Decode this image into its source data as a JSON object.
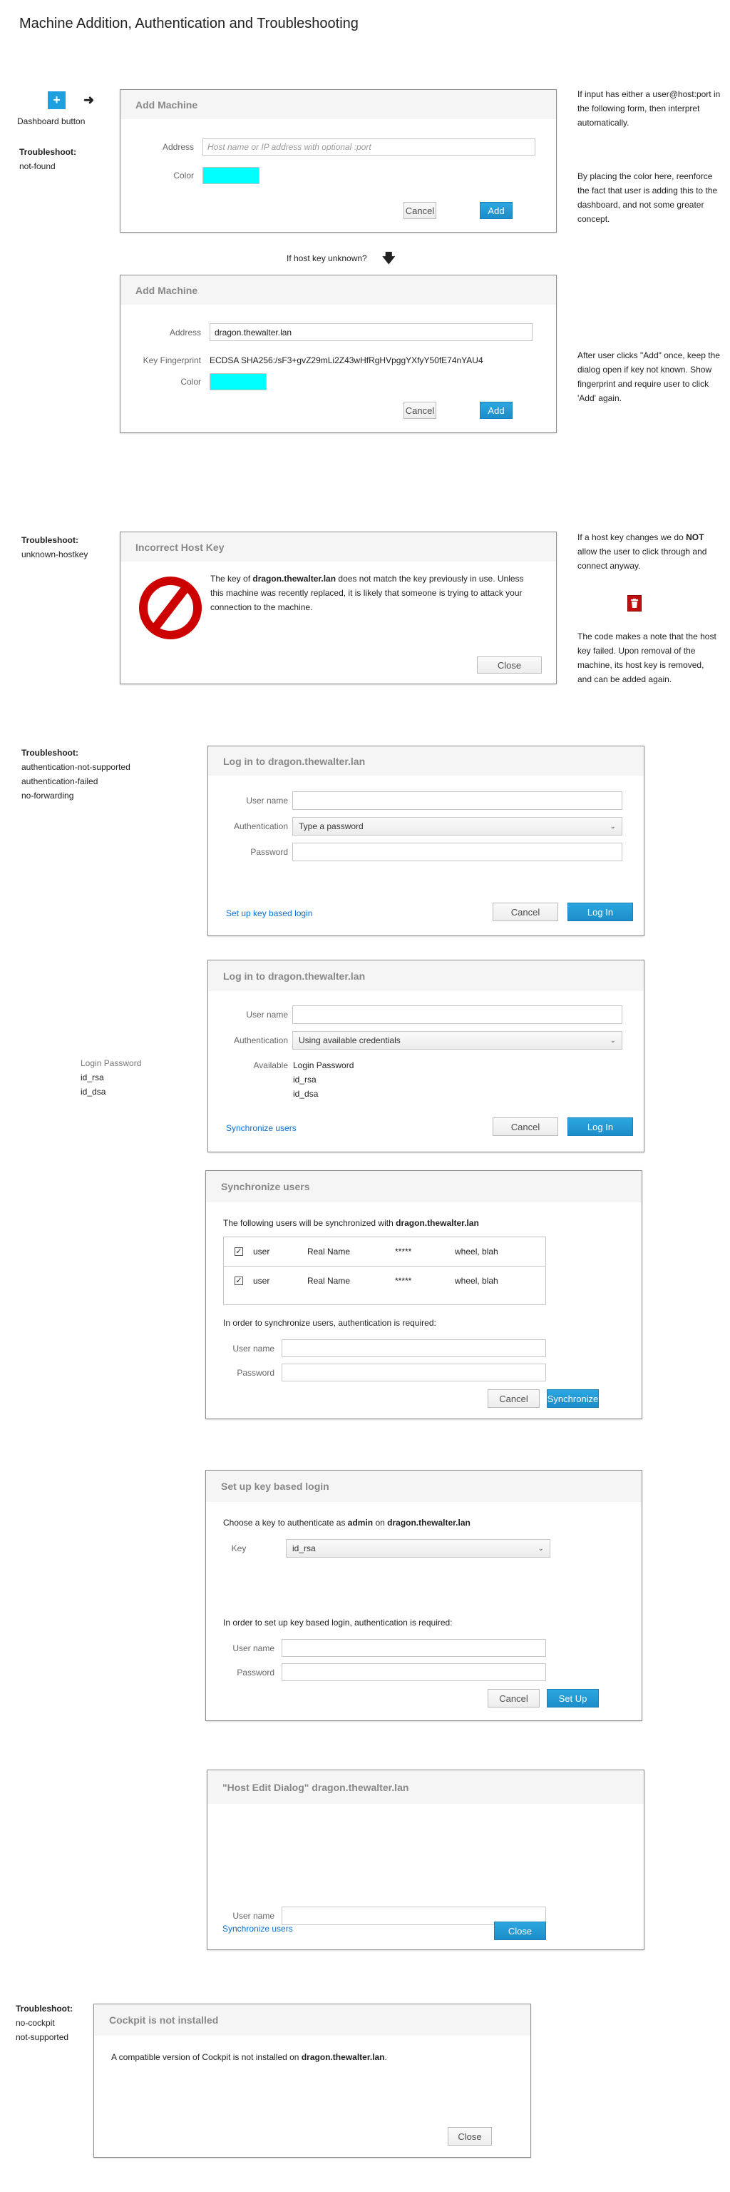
{
  "title": "Machine Addition, Authentication and Troubleshooting",
  "dashboard": {
    "button_icon": "plus-icon",
    "arrow_icon": "arrow-right-icon",
    "label": "Dashboard button"
  },
  "troubleshoot_label": "Troubleshoot:",
  "section1": {
    "troubleshoot_items": [
      "not-found"
    ],
    "notes": {
      "input_format": "If input has either a user@host:port in the following form, then interpret automatically.",
      "color_placement": "By placing the color here, reenforce the fact that user is adding this to the dashboard, and not some greater concept."
    },
    "dialog": {
      "title": "Add Machine",
      "address_label": "Address",
      "address_placeholder": "Host name or IP address with optional :port",
      "color_label": "Color",
      "color_value": "#00ffff",
      "cancel_label": "Cancel",
      "add_label": "Add"
    }
  },
  "host_key_unknown": {
    "label": "If host key unknown?",
    "arrow_icon": "arrow-down-icon"
  },
  "section2": {
    "note": "After user clicks \"Add\" once, keep the dialog open if key not known. Show fingerprint and require user to click 'Add' again.",
    "dialog": {
      "title": "Add Machine",
      "address_label": "Address",
      "address_value": "dragon.thewalter.lan",
      "fingerprint_label": "Key Fingerprint",
      "fingerprint_value": "ECDSA SHA256:/sF3+gvZ29mLi2Z43wHfRgHVpggYXfyY50fE74nYAU4",
      "color_label": "Color",
      "color_value": "#00ffff",
      "cancel_label": "Cancel",
      "add_label": "Add"
    }
  },
  "section3": {
    "troubleshoot_items": [
      "unknown-hostkey"
    ],
    "notes": {
      "first_pre": "If a host key changes we do ",
      "first_bold": "NOT",
      "first_post": " allow the user to click through and connect anyway.",
      "second": "The code makes a note that the host key failed. Upon removal of the machine, its host key is removed, and can be added again."
    },
    "trash_icon": "trash-icon",
    "dialog": {
      "title": "Incorrect Host Key",
      "icon": "prohibited-icon",
      "message_pre": "The key of ",
      "message_host": "dragon.thewalter.lan",
      "message_post": " does not match the key previously in use. Unless this machine was recently replaced, it is likely that someone is trying to attack your connection to the machine.",
      "close_label": "Close"
    }
  },
  "section4": {
    "troubleshoot_items": [
      "authentication-not-supported",
      "authentication-failed",
      "no-forwarding"
    ],
    "dialog": {
      "title": "Log in to dragon.thewalter.lan",
      "username_label": "User name",
      "auth_label": "Authentication",
      "auth_selected": "Type a password",
      "password_label": "Password",
      "link_label": "Set up key based login",
      "cancel_label": "Cancel",
      "login_label": "Log In"
    }
  },
  "section5": {
    "side_list": [
      "Login Password",
      "id_rsa",
      "id_dsa"
    ],
    "dialog": {
      "title": "Log in to dragon.thewalter.lan",
      "username_label": "User name",
      "auth_label": "Authentication",
      "auth_selected": "Using available credentials",
      "available_label": "Available",
      "available_items": [
        "Login Password",
        "id_rsa",
        "id_dsa"
      ],
      "link_label": "Synchronize users",
      "cancel_label": "Cancel",
      "login_label": "Log In"
    }
  },
  "section6": {
    "dialog": {
      "title": "Synchronize users",
      "intro_pre": "The following users will be synchronized with ",
      "intro_host": "dragon.thewalter.lan",
      "users": [
        {
          "checked": true,
          "user": "user",
          "real_name": "Real Name",
          "password": "*****",
          "groups": "wheel, blah"
        },
        {
          "checked": true,
          "user": "user",
          "real_name": "Real Name",
          "password": "*****",
          "groups": "wheel, blah"
        }
      ],
      "auth_note": "In order to synchronize users, authentication is required:",
      "username_label": "User name",
      "password_label": "Password",
      "cancel_label": "Cancel",
      "sync_label": "Synchronize"
    }
  },
  "section7": {
    "dialog": {
      "title": "Set up key based login",
      "intro_pre": "Choose a key to authenticate as ",
      "intro_user": "admin",
      "intro_mid": " on ",
      "intro_host": "dragon.thewalter.lan",
      "key_label": "Key",
      "key_selected": "id_rsa",
      "auth_note": "In order to set up key based login, authentication is required:",
      "username_label": "User name",
      "password_label": "Password",
      "cancel_label": "Cancel",
      "setup_label": "Set Up"
    }
  },
  "section8": {
    "dialog": {
      "title": "\"Host Edit Dialog\" dragon.thewalter.lan",
      "username_label": "User name",
      "link_label": "Synchronize users",
      "close_label": "Close"
    }
  },
  "section9": {
    "troubleshoot_items": [
      "no-cockpit",
      "not-supported"
    ],
    "dialog": {
      "title": "Cockpit is not installed",
      "message_pre": "A compatible version of Cockpit is not installed on ",
      "message_host": "dragon.thewalter.lan",
      "message_post": ".",
      "close_label": "Close"
    }
  }
}
